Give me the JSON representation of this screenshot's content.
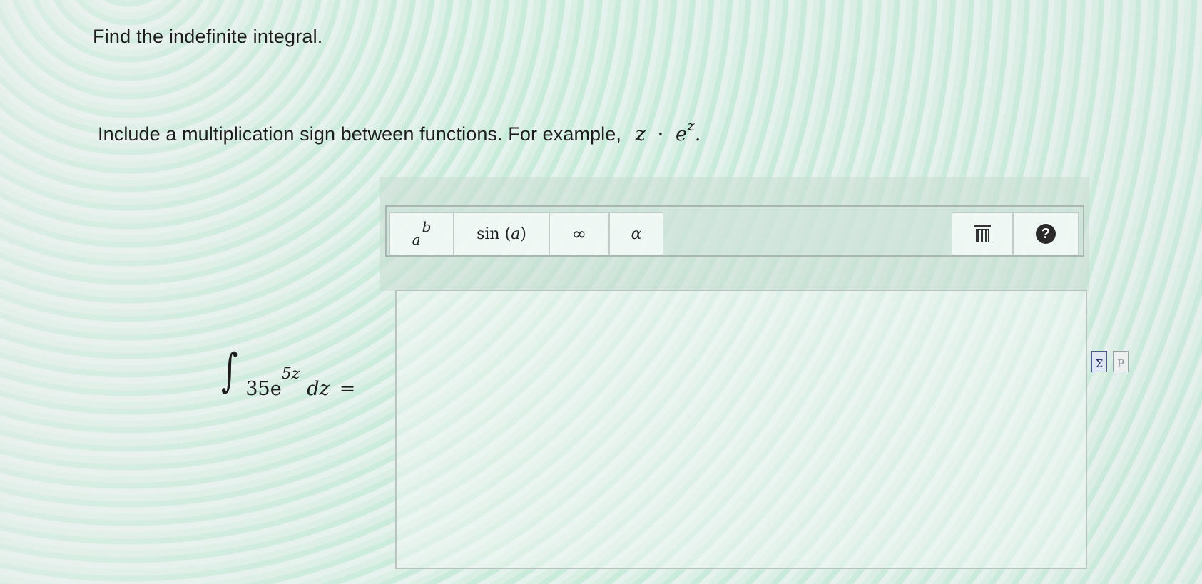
{
  "question": {
    "title": "Find the indefinite integral.",
    "instruction": "Include a multiplication sign between functions. For example,",
    "example": {
      "left": "z",
      "operator": "·",
      "base": "e",
      "exponent": "z",
      "trail": "."
    }
  },
  "integral": {
    "sign": "∫",
    "coefficient": "35",
    "base": "e",
    "exponent": "5z",
    "differential": "dz",
    "equals": "="
  },
  "toolbar": {
    "power": {
      "base": "a",
      "exponent": "b"
    },
    "trig": {
      "func": "sin",
      "open": "(",
      "arg": "a",
      "close": ")"
    },
    "infinity": "∞",
    "greek": "α",
    "trash_icon": "trash-icon",
    "help_icon": "help-icon",
    "help_glyph": "?"
  },
  "answer": {
    "value": ""
  },
  "side_icons": {
    "equation_editor": "Σ",
    "preview": "P"
  }
}
